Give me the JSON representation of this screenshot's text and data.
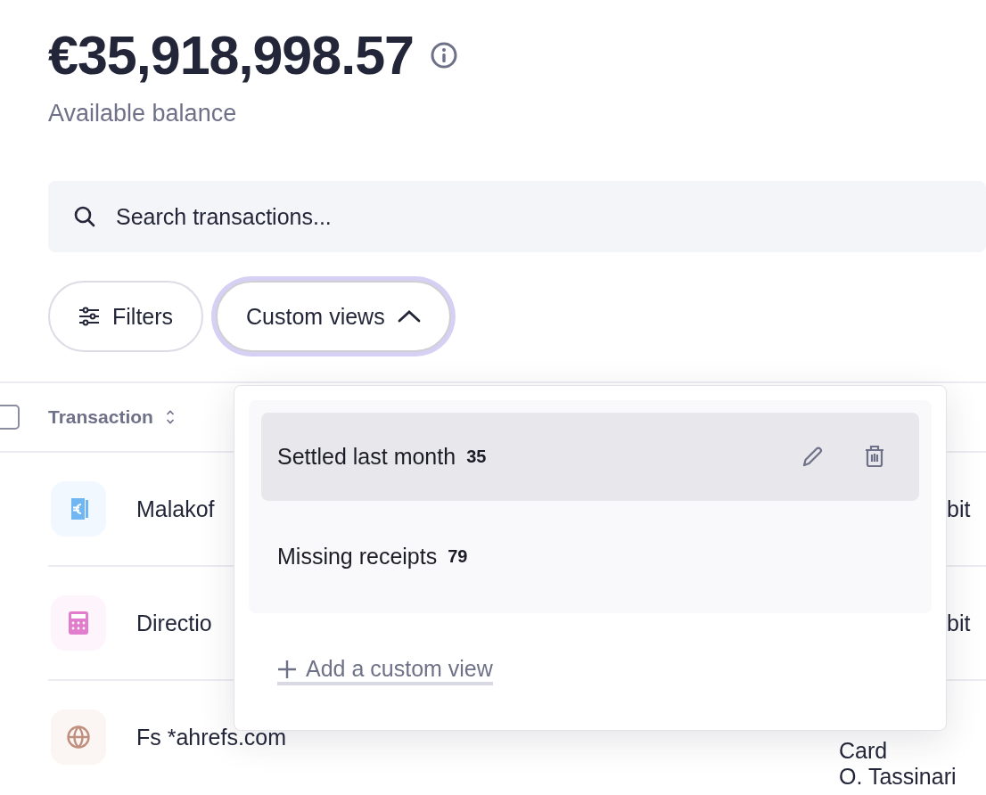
{
  "balance": {
    "amount": "€35,918,998.57",
    "label": "Available balance"
  },
  "search": {
    "placeholder": "Search transactions..."
  },
  "filters_button": {
    "label": "Filters"
  },
  "custom_views_button": {
    "label": "Custom views",
    "expanded": true
  },
  "table": {
    "select_all": {
      "checked": false
    },
    "columns": [
      {
        "label": "Transaction"
      }
    ],
    "rows": [
      {
        "kind": "receipt",
        "name": "Malakof",
        "column_2": [
          "bit"
        ]
      },
      {
        "kind": "calculator",
        "name": "Directio",
        "column_2": [
          "bit"
        ]
      },
      {
        "kind": "globe",
        "name": "Fs *ahrefs.com",
        "column_2": [
          "Card",
          "O. Tassinari"
        ]
      }
    ]
  },
  "views_menu": {
    "views": [
      {
        "name": "Settled last month",
        "count": "35",
        "selected": true
      },
      {
        "name": "Missing receipts",
        "count": "79",
        "selected": false
      }
    ],
    "add_label": "Add a custom view"
  }
}
